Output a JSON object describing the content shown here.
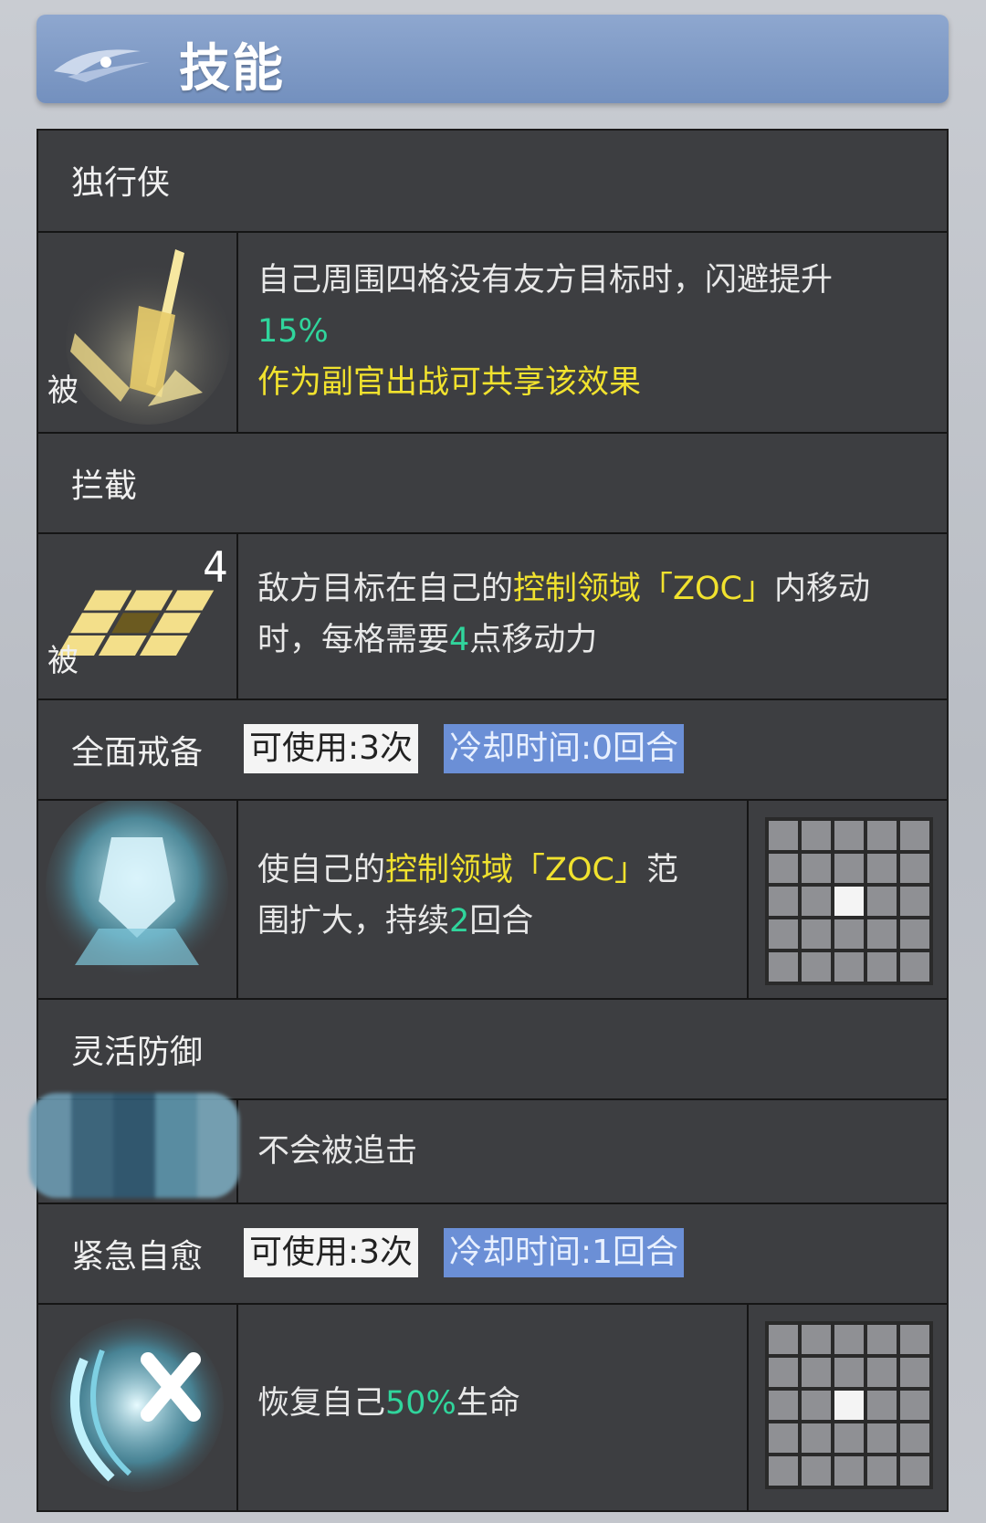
{
  "header": {
    "title": "技能"
  },
  "passive_label": "被",
  "skills": [
    {
      "name": "独行侠",
      "desc_line1": "自己周围四格没有友方目标时，闪避提升",
      "desc_value": "15%",
      "desc_line3": "作为副官出战可共享该效果"
    },
    {
      "name": "拦截",
      "desc_a": "敌方目标在自己的",
      "desc_zoc": "控制领域「ZOC」",
      "desc_b": "内移动",
      "desc_c": "时，每格需要",
      "desc_num": "4",
      "desc_d": "点移动力",
      "icon_number": "4"
    },
    {
      "name": "全面戒备",
      "uses": "可使用:3次",
      "cooldown": "冷却时间:0回合",
      "desc_a": "使自己的",
      "desc_zoc": "控制领域「ZOC」",
      "desc_b": "范",
      "desc_c": "围扩大，持续",
      "desc_num": "2",
      "desc_d": "回合"
    },
    {
      "name": "灵活防御",
      "desc": "不会被追击"
    },
    {
      "name": "紧急自愈",
      "uses": "可使用:3次",
      "cooldown": "冷却时间:1回合",
      "desc_a": "恢复自己",
      "desc_num": "50%",
      "desc_b": "生命"
    }
  ],
  "colors": {
    "highlight_yellow": "#f1e22e",
    "highlight_green": "#30d59c",
    "cooldown_bg": "#6b8fd6"
  }
}
